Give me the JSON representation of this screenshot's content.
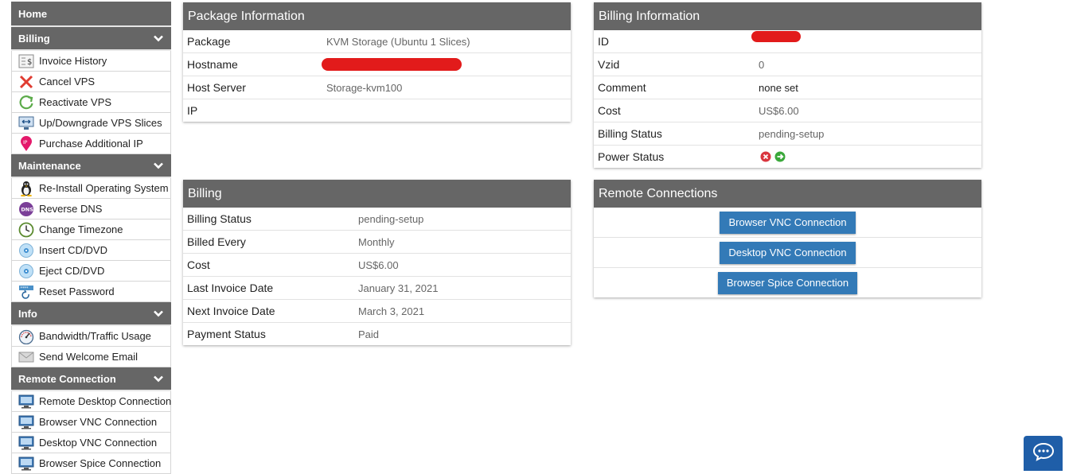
{
  "sidebar": {
    "home": "Home",
    "sections": [
      {
        "title": "Billing",
        "items": [
          "Invoice History",
          "Cancel VPS",
          "Reactivate VPS",
          "Up/Downgrade VPS Slices",
          "Purchase Additional IP"
        ]
      },
      {
        "title": "Maintenance",
        "items": [
          "Re-Install Operating System",
          "Reverse DNS",
          "Change Timezone",
          "Insert CD/DVD",
          "Eject CD/DVD",
          "Reset Password"
        ]
      },
      {
        "title": "Info",
        "items": [
          "Bandwidth/Traffic Usage",
          "Send Welcome Email"
        ]
      },
      {
        "title": "Remote Connection",
        "items": [
          "Remote Desktop Connection",
          "Browser VNC Connection",
          "Desktop VNC Connection",
          "Browser Spice Connection"
        ]
      }
    ],
    "icons": {
      "billing": [
        "invoice-icon",
        "cancel-x-icon",
        "reactivate-icon",
        "resize-slices-icon",
        "ip-pin-icon"
      ],
      "maintenance": [
        "linux-penguin-icon",
        "dns-icon",
        "clock-icon",
        "cd-icon",
        "cd-icon",
        "password-icon"
      ],
      "info": [
        "speedometer-icon",
        "envelope-icon"
      ],
      "remote": [
        "monitor-icon",
        "monitor-icon",
        "monitor-icon",
        "monitor-icon"
      ]
    }
  },
  "package_info": {
    "title": "Package Information",
    "rows": [
      {
        "label": "Package",
        "value": "KVM Storage (Ubuntu 1 Slices)"
      },
      {
        "label": "Hostname",
        "value": ""
      },
      {
        "label": "Host Server",
        "value": "Storage-kvm100"
      },
      {
        "label": "IP",
        "value": ""
      }
    ]
  },
  "billing_info": {
    "title": "Billing Information",
    "rows": [
      {
        "label": "ID",
        "value": ""
      },
      {
        "label": "Vzid",
        "value": "0"
      },
      {
        "label": "Comment",
        "value": "none set"
      },
      {
        "label": "Cost",
        "value": "US$6.00"
      },
      {
        "label": "Billing Status",
        "value": "pending-setup"
      },
      {
        "label": "Power Status",
        "value": ""
      }
    ]
  },
  "billing": {
    "title": "Billing",
    "rows": [
      {
        "label": "Billing Status",
        "value": "pending-setup"
      },
      {
        "label": "Billed Every",
        "value": "Monthly"
      },
      {
        "label": "Cost",
        "value": "US$6.00"
      },
      {
        "label": "Last Invoice Date",
        "value": "January 31, 2021"
      },
      {
        "label": "Next Invoice Date",
        "value": "March 3, 2021"
      },
      {
        "label": "Payment Status",
        "value": "Paid"
      }
    ]
  },
  "remote_connections": {
    "title": "Remote Connections",
    "buttons": [
      "Browser VNC Connection",
      "Desktop VNC Connection",
      "Browser Spice Connection"
    ]
  },
  "colors": {
    "header": "#666666",
    "button": "#337ab7",
    "redaction": "#e21b1b",
    "chat": "#1f5ea8"
  }
}
